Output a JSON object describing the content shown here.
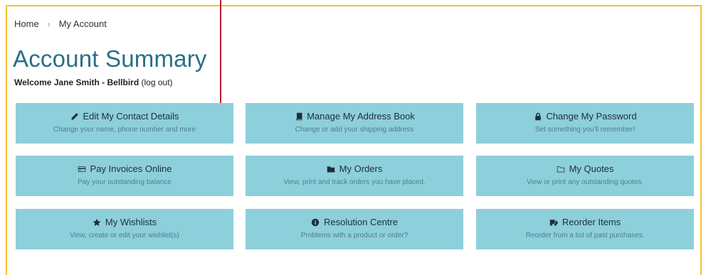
{
  "breadcrumb": {
    "home": "Home",
    "separator": "›",
    "current": "My Account"
  },
  "page_title": "Account Summary",
  "welcome": {
    "prefix": "Welcome",
    "user": "Jane Smith - Bellbird",
    "logout": "(log out)"
  },
  "colors": {
    "tile_bg": "#8ecfdc",
    "title": "#2a6f86",
    "frame": "#f2c22e",
    "marker": "#b51f2e"
  },
  "tiles": [
    {
      "icon": "pencil-icon",
      "title": "Edit My Contact Details",
      "desc": "Change your name, phone number and more"
    },
    {
      "icon": "address-book-icon",
      "title": "Manage My Address Book",
      "desc": "Change or add your shipping address"
    },
    {
      "icon": "lock-icon",
      "title": "Change My Password",
      "desc": "Set something you'll remember!"
    },
    {
      "icon": "credit-card-icon",
      "title": "Pay Invoices Online",
      "desc": "Pay your outstanding balance"
    },
    {
      "icon": "folder-icon",
      "title": "My Orders",
      "desc": "View, print and track orders you have placed."
    },
    {
      "icon": "folder-open-icon",
      "title": "My Quotes",
      "desc": "View or print any outstanding quotes."
    },
    {
      "icon": "star-icon",
      "title": "My Wishlists",
      "desc": "View, create or edit your wishlist(s)"
    },
    {
      "icon": "info-circle-icon",
      "title": "Resolution Centre",
      "desc": "Problems with a product or order?"
    },
    {
      "icon": "truck-icon",
      "title": "Reorder Items",
      "desc": "Reorder from a list of past purchases."
    }
  ]
}
